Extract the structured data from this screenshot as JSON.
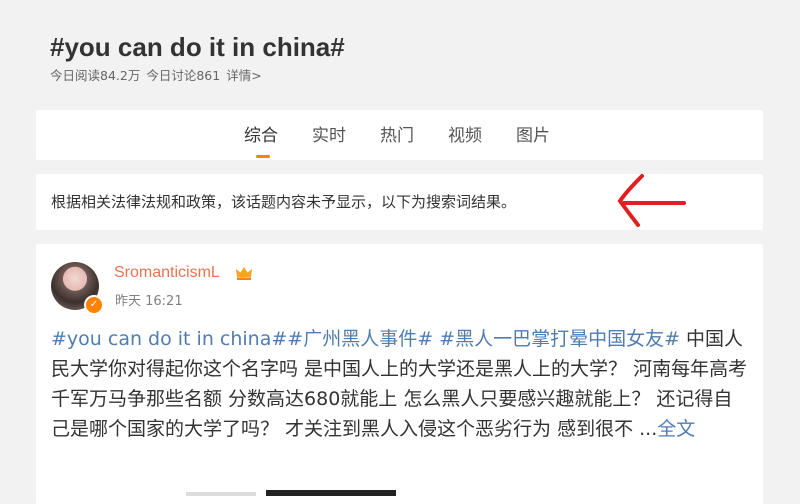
{
  "topic": {
    "title": "#you can do it in china#",
    "read_today": "今日阅读84.2万",
    "discuss_today": "今日讨论861",
    "details_label": "详情>"
  },
  "tabs": [
    {
      "label": "综合",
      "active": true
    },
    {
      "label": "实时",
      "active": false
    },
    {
      "label": "热门",
      "active": false
    },
    {
      "label": "视频",
      "active": false
    },
    {
      "label": "图片",
      "active": false
    }
  ],
  "notice": {
    "text": "根据相关法律法规和政策，该话题内容未予显示，以下为搜索词结果。"
  },
  "post": {
    "username": "SromanticismL",
    "time": "昨天 16:21",
    "tag1": "#you can do it in china#",
    "tag2": "#广州黑人事件#",
    "tag3": "#黑人一巴掌打晕中国女友#",
    "body": " 中国人民大学你对得起你这个名字吗 是中国人上的大学还是黑人上的大学？ 河南每年高考千军万马争那些名额 分数高达680就能上 怎么黑人只要感兴趣就能上？ 还记得自己是哪个国家的大学了吗？ 才关注到黑人入侵这个恶劣行为 感到很不 ...",
    "expand_label": "全文"
  },
  "colors": {
    "accent": "#ff8200",
    "link": "#507daf",
    "username": "#eb7350",
    "annotation_arrow": "#e02020"
  },
  "icons": {
    "avatar": "user-avatar-photo",
    "verified": "verified-badge-icon",
    "member": "crown-icon",
    "annotation": "red-arrow-annotation"
  }
}
